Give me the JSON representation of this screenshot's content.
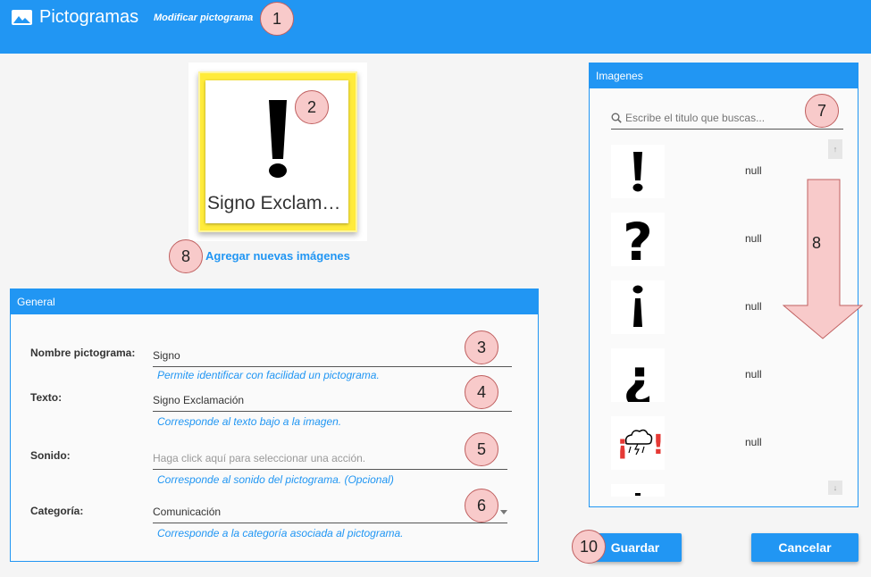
{
  "header": {
    "title": "Pictogramas",
    "subtitle": "Modificar pictograma",
    "icon": "image-icon"
  },
  "preview": {
    "label": "Signo Exclamación",
    "glyph": "!",
    "add_images_label": "Agregar nuevas imágenes"
  },
  "general": {
    "title": "General",
    "fields": [
      {
        "label": "Nombre pictograma:",
        "value": "Signo",
        "help": "Permite identificar con facilidad un pictograma."
      },
      {
        "label": "Texto:",
        "value": "Signo Exclamación",
        "help": "Corresponde al texto bajo a la imagen."
      },
      {
        "label": "Sonido:",
        "placeholder": "Haga click aquí para seleccionar una acción.",
        "help": "Corresponde al sonido del pictograma. (Opcional)"
      },
      {
        "label": "Categoría:",
        "value": "Comunicación",
        "help": "Corresponde a la categoría asociada al pictograma."
      }
    ]
  },
  "images": {
    "title": "Imagenes",
    "search_placeholder": "Escribe el titulo que buscas...",
    "items": [
      {
        "glyph": "!",
        "text": "null"
      },
      {
        "glyph": "?",
        "text": "null"
      },
      {
        "glyph": "¡",
        "text": "null"
      },
      {
        "glyph": "¿",
        "text": "null"
      },
      {
        "glyph": "rain-cloud",
        "text": "null"
      }
    ]
  },
  "buttons": {
    "save": "Guardar",
    "cancel": "Cancelar"
  },
  "markers": [
    "1",
    "2",
    "3",
    "4",
    "5",
    "6",
    "7",
    "8",
    "8",
    "10"
  ],
  "colors": {
    "primary": "#2196f3",
    "highlight": "#ffeb3b",
    "marker": "#f8caca",
    "arrow": "#f8caca"
  }
}
